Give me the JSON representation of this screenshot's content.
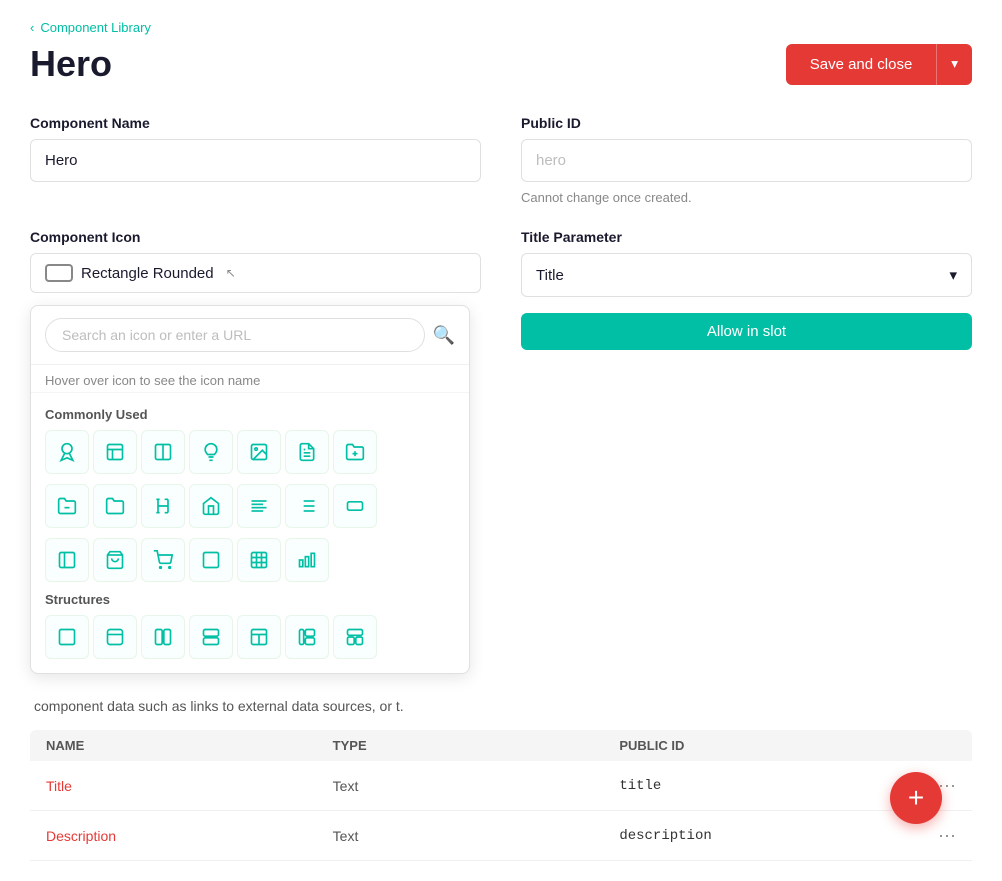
{
  "breadcrumb": {
    "chevron": "‹",
    "label": "Component Library"
  },
  "header": {
    "title": "Hero",
    "save_close_label": "Save and close",
    "dropdown_icon": "▾"
  },
  "form": {
    "component_name_label": "Component Name",
    "component_name_value": "Hero",
    "public_id_label": "Public ID",
    "public_id_placeholder": "hero",
    "public_id_hint": "Cannot change once created.",
    "component_icon_label": "Component Icon",
    "selected_icon_label": "Rectangle Rounded",
    "title_parameter_label": "Title Parameter",
    "title_parameter_value": "Title",
    "allow_slot_label": "Allow in slot"
  },
  "icon_picker": {
    "search_placeholder": "Search an icon or enter a URL",
    "hover_hint": "Hover over icon to see the icon name",
    "commonly_used_label": "Commonly Used",
    "structures_label": "Structures",
    "icons_row1": [
      "🔮",
      "▭",
      "▭",
      "💡",
      "🖼",
      "📄",
      "📁"
    ],
    "icons_row2": [
      "📂",
      "📂",
      "H",
      "🏠",
      "≡",
      "📋",
      "▭"
    ],
    "icons_row3": [
      "📤",
      "🛍",
      "🛒",
      "▭",
      "⊞",
      "▤"
    ]
  },
  "table": {
    "columns": [
      "NAME",
      "TYPE",
      "PUBLIC ID",
      ""
    ],
    "rows": [
      {
        "name": "Title",
        "type": "Text",
        "public_id": "title",
        "menu": "···"
      },
      {
        "name": "Description",
        "type": "Text",
        "public_id": "description",
        "menu": "···"
      }
    ]
  },
  "fab_icon": "+",
  "bottom_hint": "component data such as links to external data sources, or t."
}
